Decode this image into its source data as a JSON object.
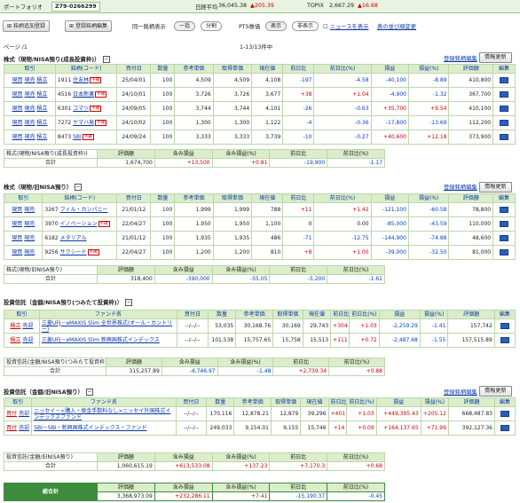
{
  "topbar": {
    "portfolio_label": "ポートフォリオ",
    "portfolio_value": "Z79-0266299",
    "nikkei_label": "日経平均",
    "nikkei_value": "36,045.38",
    "nikkei_change": "▲205.39",
    "topix_label": "TOPIX",
    "topix_value": "2,667.29",
    "topix_change": "▲16.68"
  },
  "toolbar": {
    "add_label": "銘柄追加登録",
    "edit_label": "登録銘柄編集",
    "same_label": "同一銘柄表示",
    "lump_label": "一括",
    "split_label": "分割",
    "pts_label": "PTS株価",
    "show_label": "表示",
    "hide_label": "非表示",
    "news_label": "ニュースを表示",
    "guide_label": "表の並び順変更"
  },
  "paging": {
    "page": "ページ /1",
    "range": "1-13/13件中"
  },
  "common": {
    "register_link": "登録銘柄編集",
    "update_btn": "情報更新",
    "box": "−"
  },
  "sec1": {
    "title": "株式（現物/NISA預り(成長投資枠)）",
    "headers": [
      "取引",
      "銘柄(コード)",
      "買付日",
      "数量",
      "参考単価",
      "取得単価",
      "現在値",
      "前日比",
      "前日比(%)",
      "損益",
      "損益(%)",
      "評価額",
      "編集"
    ],
    "rows": [
      {
        "a": "現買",
        "b": "現売",
        "c": "積立",
        "code": "1911",
        "name": "住友林",
        "tag": "不確",
        "date": "25/04/01",
        "qty": "100",
        "ref": "4,509",
        "cost": "4,509",
        "now": "4,108",
        "chg": "-197",
        "chgp": "-4.58",
        "pl": "-40,100",
        "plp": "-8.89",
        "val": "410,800"
      },
      {
        "a": "現買",
        "b": "現売",
        "c": "積立",
        "code": "4516",
        "name": "日本新薬",
        "tag": "不確",
        "date": "24/10/01",
        "qty": "100",
        "ref": "3,726",
        "cost": "3,726",
        "now": "3,677",
        "chg": "+38",
        "chgp": "+1.04",
        "pl": "-4,900",
        "plp": "-1.32",
        "val": "367,700"
      },
      {
        "a": "現買",
        "b": "現売",
        "c": "積立",
        "code": "6301",
        "name": "コマツ",
        "tag": "不確",
        "date": "24/09/05",
        "qty": "100",
        "ref": "3,744",
        "cost": "3,744",
        "now": "4,101",
        "chg": "-26",
        "chgp": "-0.63",
        "pl": "+35,700",
        "plp": "+9.54",
        "val": "410,100"
      },
      {
        "a": "現買",
        "b": "現売",
        "c": "積立",
        "code": "7272",
        "name": "ヤマハ発",
        "tag": "不確",
        "date": "24/10/02",
        "qty": "100",
        "ref": "1,300",
        "cost": "1,300",
        "now": "1,122",
        "chg": "-4",
        "chgp": "-0.36",
        "pl": "-17,800",
        "plp": "-13.69",
        "val": "112,200"
      },
      {
        "a": "現買",
        "b": "現売",
        "c": "積立",
        "code": "8473",
        "name": "SBI",
        "tag": "不確",
        "date": "24/09/24",
        "qty": "100",
        "ref": "3,333",
        "cost": "3,333",
        "now": "3,739",
        "chg": "-10",
        "chgp": "-0.27",
        "pl": "+40,600",
        "plp": "+12.18",
        "val": "373,900"
      }
    ],
    "sum": {
      "label": "株式(現物/NISA預り(成長投資枠))",
      "total": "合計",
      "h1": "評価額",
      "h2": "含み損益",
      "h3": "含み損益(%)",
      "h4": "前日比",
      "h5": "前日比(%)",
      "v1": "1,674,700",
      "v2": "+13,500",
      "v3": "+0.81",
      "v4": "-19,900",
      "v5": "-1.17"
    }
  },
  "sec2": {
    "title": "株式（現物/旧NISA預り）",
    "headers": [
      "取引",
      "銘柄(コード)",
      "買付日",
      "数量",
      "参考単価",
      "取得単価",
      "現在値",
      "前日比",
      "前日比(%)",
      "損益",
      "損益(%)",
      "評価額",
      "編集"
    ],
    "rows": [
      {
        "a": "現買",
        "b": "現売",
        "code": "3267",
        "name": "フィル・カンパニー",
        "tag": "",
        "date": "21/01/12",
        "qty": "100",
        "ref": "1,999",
        "cost": "1,999",
        "now": "788",
        "chg": "+11",
        "chgp": "+1.42",
        "pl": "-121,100",
        "plp": "-60.58",
        "val": "78,800"
      },
      {
        "a": "現買",
        "b": "現売",
        "code": "3970",
        "name": "イノベーション",
        "tag": "不確",
        "date": "22/04/27",
        "qty": "100",
        "ref": "1,950",
        "cost": "1,950",
        "now": "1,100",
        "chg": "0",
        "chgp": "0.00",
        "pl": "-85,000",
        "plp": "-43.59",
        "val": "110,000"
      },
      {
        "a": "現買",
        "b": "現売",
        "code": "6182",
        "name": "メタリアル",
        "tag": "",
        "date": "21/01/12",
        "qty": "100",
        "ref": "1,935",
        "cost": "1,935",
        "now": "486",
        "chg": "-71",
        "chgp": "-12.75",
        "pl": "-144,900",
        "plp": "-74.88",
        "val": "48,600"
      },
      {
        "a": "現買",
        "b": "現売",
        "code": "9256",
        "name": "サクシード",
        "tag": "不確",
        "date": "22/04/27",
        "qty": "100",
        "ref": "1,200",
        "cost": "1,200",
        "now": "810",
        "chg": "+8",
        "chgp": "+1.00",
        "pl": "-39,000",
        "plp": "-32.50",
        "val": "81,000"
      }
    ],
    "sum": {
      "label": "株式(現物/旧NISA預り)",
      "total": "合計",
      "h1": "評価額",
      "h2": "含み損益",
      "h3": "含み損益(%)",
      "h4": "前日比",
      "h5": "前日比(%)",
      "v1": "318,400",
      "v2": "-390,000",
      "v3": "-55.05",
      "v4": "-5,200",
      "v5": "-1.61"
    }
  },
  "sec3": {
    "title": "投資信託（金額/NISA預り(つみたて投資枠)）",
    "headers": [
      "取引",
      "ファンド名",
      "買付日",
      "数量",
      "参考単価",
      "取得単価",
      "現在値",
      "前日比",
      "前日比(%)",
      "損益",
      "損益(%)",
      "評価額",
      "編集"
    ],
    "rows": [
      {
        "a": "積立",
        "b": "売却",
        "name": "三菱UFJ－eMAXIS Slim 全世界株式(オール・カントリー)",
        "date": "--/--/--",
        "qty": "53,035",
        "ref": "30,168.76",
        "cost": "30,169",
        "now": "29,743",
        "chg": "+304",
        "chgp": "+1.03",
        "pl": "-2,259.29",
        "plp": "-1.41",
        "val": "157,742"
      },
      {
        "a": "積立",
        "b": "売却",
        "name": "三菱UFJ－eMAXIS Slim 新興国株式インデックス",
        "date": "--/--/--",
        "qty": "101,538",
        "ref": "15,757.65",
        "cost": "15,758",
        "now": "15,513",
        "chg": "+111",
        "chgp": "+0.72",
        "pl": "-2,487.68",
        "plp": "-1.55",
        "val": "157,515.89"
      }
    ],
    "sum": {
      "label": "投資信託(金額/NISA預り(つみたて投資枠))",
      "total": "合計",
      "h1": "評価額",
      "h2": "含み損益",
      "h3": "含み損益(%)",
      "h4": "前日比",
      "h5": "前日比(%)",
      "v1": "315,257.89",
      "v2": "-4,746.97",
      "v3": "-1.48",
      "v4": "+2,739.34",
      "v5": "+0.88"
    }
  },
  "sec4": {
    "title": "投資信託（金額/旧NISA預り）",
    "headers": [
      "取引",
      "ファンド名",
      "買付日",
      "数量",
      "参考単価",
      "取得単価",
      "現在値",
      "前日比",
      "前日比(%)",
      "損益",
      "損益(%)",
      "評価額",
      "編集"
    ],
    "rows": [
      {
        "a": "買付",
        "b": "売却",
        "name": "ニッセイ－<購入・換金手数料なし>ニッセイ外国株式インデックスファンド",
        "date": "--/--/--",
        "qty": "170,116",
        "ref": "12,878.21",
        "cost": "12,879",
        "now": "39,296",
        "chg": "+401",
        "chgp": "+1.03",
        "pl": "+449,395.43",
        "plp": "+205.12",
        "val": "668,487.83"
      },
      {
        "a": "買付",
        "b": "売却",
        "name": "SBI－SBI・新興国株式インデックス・ファンド",
        "date": "--/--/--",
        "qty": "249,033",
        "ref": "9,154.01",
        "cost": "9,155",
        "now": "15,746",
        "chg": "+14",
        "chgp": "+0.09",
        "pl": "+164,137.65",
        "plp": "+71.99",
        "val": "392,127.36"
      }
    ],
    "sum": {
      "label": "投資信託(金額/旧NISA預り)",
      "total": "合計",
      "h1": "評価額",
      "h2": "含み損益",
      "h3": "含み損益(%)",
      "h4": "前日比",
      "h5": "前日比(%)",
      "v1": "1,060,615.19",
      "v2": "+613,533.08",
      "v3": "+137.23",
      "v4": "+7,170.3",
      "v5": "+0.68"
    }
  },
  "grand": {
    "label": "総合計",
    "h1": "評価額",
    "h2": "含み損益",
    "h3": "含み損益(%)",
    "h4": "前日比",
    "h5": "前日比(%)",
    "v1": "3,368,973.09",
    "v2": "+232,286.11",
    "v3": "+7.41",
    "v4": "-15,190.37",
    "v5": "-0.45"
  },
  "colors": {
    "header_bg": "#dbedca",
    "border": "#bcd6ad",
    "up": "#d10000",
    "down": "#0040c0",
    "link": "#0a37a7",
    "grand": "#3d8b3d"
  }
}
